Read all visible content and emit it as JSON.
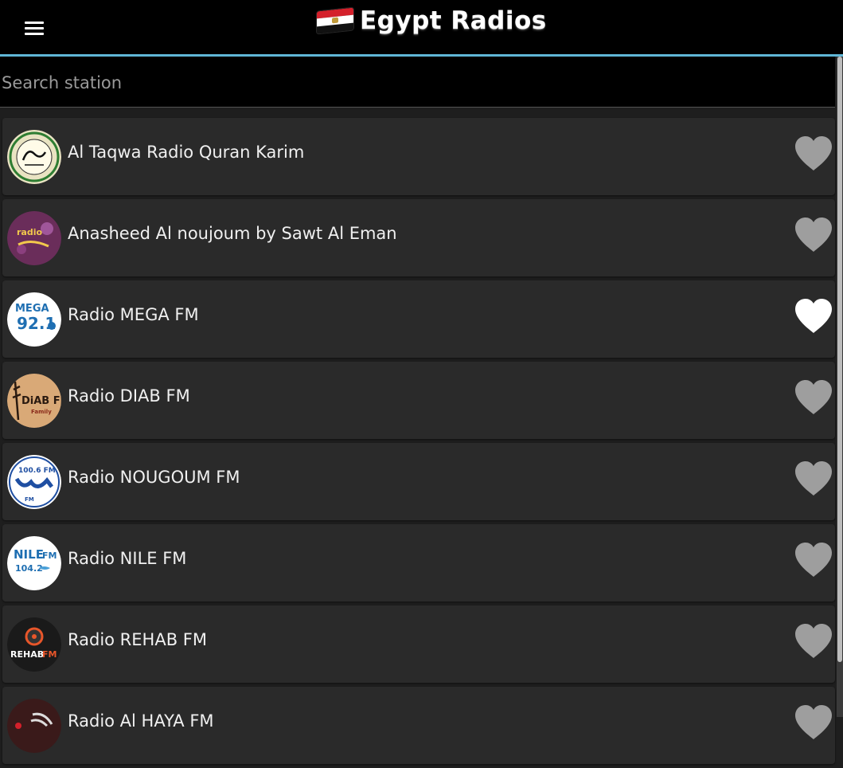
{
  "header": {
    "title": "Egypt Radios",
    "menu_icon": "hamburger-menu-icon",
    "flag_icon": "egypt-flag-icon",
    "accent_color": "#5fb6d6"
  },
  "search": {
    "placeholder": "Search station",
    "value": ""
  },
  "stations": [
    {
      "name": "Al Taqwa Radio Quran Karim",
      "favorite": false,
      "logo_text": "",
      "logo_color": "#f3efd6"
    },
    {
      "name": "Anasheed Al noujoum by Sawt Al Eman",
      "favorite": false,
      "logo_text": "",
      "logo_color": "#6a2d5a"
    },
    {
      "name": "Radio MEGA FM",
      "favorite": true,
      "logo_text": "MEGA",
      "logo_color": "#ffffff"
    },
    {
      "name": "Radio DIAB FM",
      "favorite": false,
      "logo_text": "DiAB FM",
      "logo_color": "#d9a977"
    },
    {
      "name": "Radio NOUGOUM FM",
      "favorite": false,
      "logo_text": "100.6 FM",
      "logo_color": "#ffffff"
    },
    {
      "name": "Radio NILE FM",
      "favorite": false,
      "logo_text": "NILE FM",
      "logo_color": "#ffffff"
    },
    {
      "name": "Radio REHAB FM",
      "favorite": false,
      "logo_text": "REHAB FM",
      "logo_color": "#1a1a1a"
    },
    {
      "name": "Radio Al HAYA FM",
      "favorite": false,
      "logo_text": "",
      "logo_color": "#3a1a1a"
    }
  ],
  "colors": {
    "heart_inactive": "#9e9e9e",
    "heart_active": "#ffffff"
  }
}
